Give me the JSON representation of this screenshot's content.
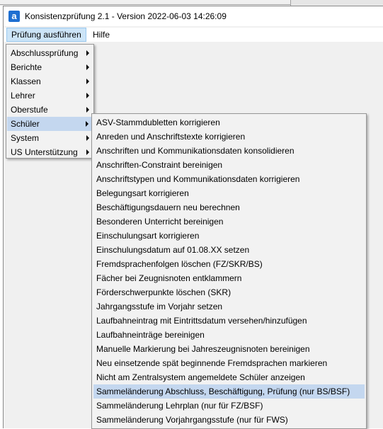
{
  "window": {
    "title": "Konsistenzprüfung 2.1 - Version 2022-06-03 14:26:09",
    "app_icon_letter": "a"
  },
  "menubar": {
    "items": [
      {
        "label": "Prüfung ausführen"
      },
      {
        "label": "Hilfe"
      }
    ]
  },
  "main_menu": {
    "items": [
      {
        "label": "Abschlussprüfung"
      },
      {
        "label": "Berichte"
      },
      {
        "label": "Klassen"
      },
      {
        "label": "Lehrer"
      },
      {
        "label": "Oberstufe"
      },
      {
        "label": "Schüler"
      },
      {
        "label": "System"
      },
      {
        "label": "US Unterstützung"
      }
    ]
  },
  "submenu": {
    "items": [
      {
        "label": "ASV-Stammdubletten korrigieren"
      },
      {
        "label": "Anreden und Anschriftstexte korrigieren"
      },
      {
        "label": "Anschriften und Kommunikationsdaten konsolidieren"
      },
      {
        "label": "Anschriften-Constraint bereinigen"
      },
      {
        "label": "Anschriftstypen und Kommunikationsdaten korrigieren"
      },
      {
        "label": "Belegungsart korrigieren"
      },
      {
        "label": "Beschäftigungsdauern neu berechnen"
      },
      {
        "label": "Besonderen Unterricht bereinigen"
      },
      {
        "label": "Einschulungsart korrigieren"
      },
      {
        "label": "Einschulungsdatum auf 01.08.XX setzen"
      },
      {
        "label": "Fremdsprachenfolgen löschen (FZ/SKR/BS)"
      },
      {
        "label": "Fächer bei Zeugnisnoten entklammern"
      },
      {
        "label": "Förderschwerpunkte löschen (SKR)"
      },
      {
        "label": "Jahrgangsstufe im Vorjahr setzen"
      },
      {
        "label": "Laufbahneintrag mit Eintrittsdatum versehen/hinzufügen"
      },
      {
        "label": "Laufbahneinträge bereinigen"
      },
      {
        "label": "Manuelle Markierung bei Jahreszeugnisnoten bereinigen"
      },
      {
        "label": "Neu einsetzende spät beginnende Fremdsprachen markieren"
      },
      {
        "label": "Nicht am Zentralsystem angemeldete Schüler anzeigen"
      },
      {
        "label": "Sammeländerung Abschluss, Beschäftigung, Prüfung (nur BS/BSF)"
      },
      {
        "label": "Sammeländerung Lehrplan (nur für FZ/BSF)"
      },
      {
        "label": "Sammeländerung Vorjahrgangsstufe (nur für FWS)"
      }
    ]
  },
  "colors": {
    "menu_highlight": "#c4d7ef",
    "menubar_open": "#cce4f7",
    "app_icon": "#1e6fd1"
  }
}
